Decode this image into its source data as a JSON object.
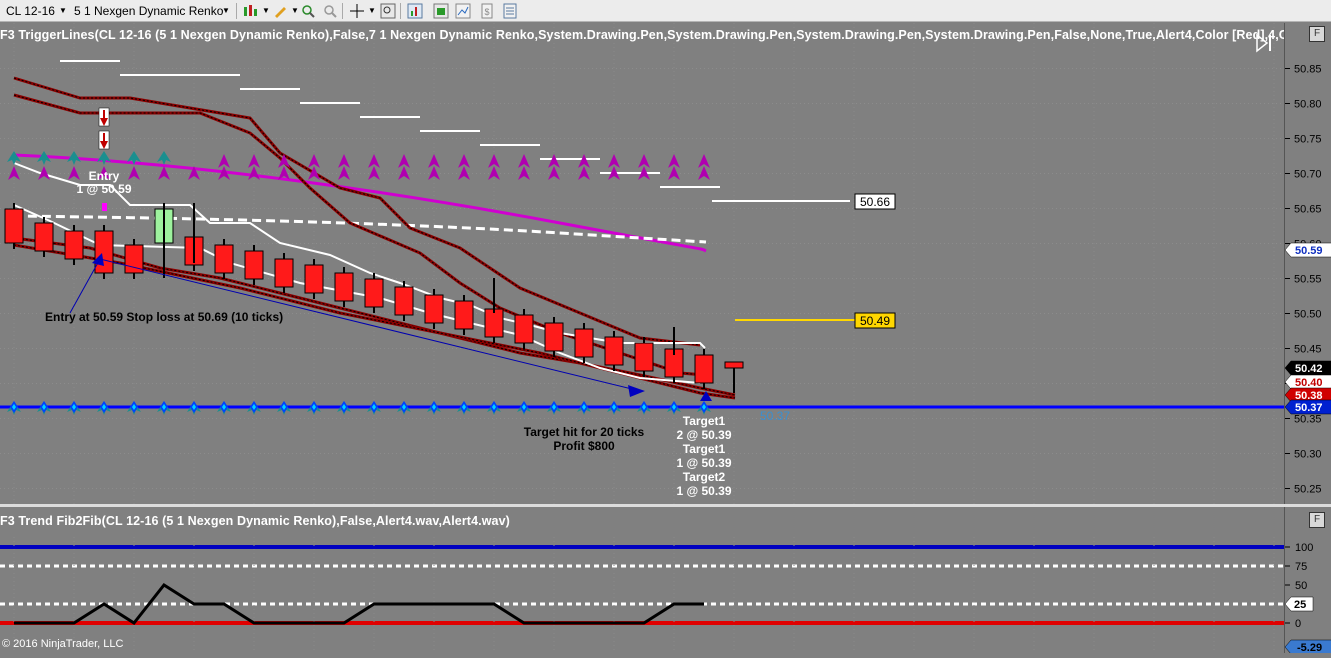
{
  "toolbar": {
    "instrument": "CL 12-16",
    "period": "5 1 Nexgen Dynamic Renko"
  },
  "price_panel": {
    "indicator_title": "F3 TriggerLines(CL 12-16 (5 1 Nexgen Dynamic Renko),False,7 1 Nexgen Dynamic Renko,System.Drawing.Pen,System.Drawing.Pen,System.Drawing.Pen,System.Drawing.Pen,False,None,True,Alert4,Color [Red],4,Color [",
    "y_ticks": [
      "50.85",
      "50.80",
      "50.75",
      "50.70",
      "50.65",
      "50.60",
      "50.55",
      "50.50",
      "50.45",
      "50.40",
      "50.35",
      "50.30",
      "50.25"
    ],
    "labels": {
      "entry": "Entry",
      "entry_qty": "1 @ 50.59",
      "entry_note": "Entry at 50.59 Stop loss at 50.69 (10 ticks)",
      "target_note_1": "Target hit for 20 ticks",
      "target_note_2": "Profit $800",
      "target1_a": "Target1",
      "target1_a_qty": "2 @ 50.39",
      "target1_b": "Target1",
      "target1_b_qty": "1 @ 50.39",
      "target2": "Target2",
      "target2_qty": "1 @ 50.39",
      "blue_line_value": "50.37"
    },
    "price_boxes": {
      "white": "50.66",
      "yellow": "50.49",
      "blue_axis_upper": "50.59",
      "last_price": "50.42",
      "red_axis": "50.40",
      "red_axis_2": "50.38",
      "blue_axis_lower": "50.37"
    }
  },
  "lower_panel": {
    "indicator_title": "F3 Trend Fib2Fib(CL 12-16 (5 1 Nexgen Dynamic Renko),False,Alert4.wav,Alert4.wav)",
    "y_ticks": [
      "100",
      "75",
      "50",
      "25",
      "0"
    ],
    "current_value": "25",
    "bottom_value": "-5.29"
  },
  "footer": {
    "copyright": "© 2016 NinjaTrader, LLC"
  },
  "colors": {
    "background": "#808080",
    "candle_down": "#ff1a1a",
    "candle_up": "#9ef29e",
    "magenta": "#c000c0",
    "teal": "#1a8f8f",
    "blue": "#0000ff",
    "yellow": "#ffd700"
  },
  "icons": [
    "dropdown-icon",
    "bar-chart-icon",
    "pencil-icon",
    "zoom-icon",
    "crosshair-icon",
    "magnifier-icon",
    "properties-icon",
    "strategy-icon",
    "templates-icon",
    "calendar-icon",
    "scroll-end-icon"
  ]
}
